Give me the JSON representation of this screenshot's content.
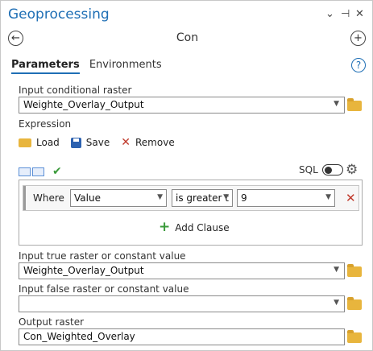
{
  "header": {
    "title": "Geoprocessing",
    "controls": {
      "dropdown": "⌄",
      "pin": "⊣",
      "close": "✕"
    }
  },
  "nav": {
    "back": "←",
    "tool_name": "Con",
    "add": "+"
  },
  "tabs": [
    {
      "label": "Parameters",
      "active": true
    },
    {
      "label": "Environments",
      "active": false
    }
  ],
  "help": "?",
  "params": {
    "cond_raster": {
      "label": "Input conditional raster",
      "value": "Weighte_Overlay_Output"
    },
    "expression": {
      "label": "Expression",
      "buttons": {
        "load": "Load",
        "save": "Save",
        "remove": "Remove"
      },
      "sql_label": "SQL",
      "clause": {
        "where": "Where",
        "field": "Value",
        "operator": "is greater t",
        "value": "9"
      },
      "add_clause": "Add Clause"
    },
    "true_raster": {
      "label": "Input true raster or constant value",
      "value": "Weighte_Overlay_Output"
    },
    "false_raster": {
      "label": "Input false raster or constant value",
      "value": ""
    },
    "output_raster": {
      "label": "Output raster",
      "value": "Con_Weighted_Overlay"
    }
  },
  "colors": {
    "accent": "#1f6fb5",
    "folder": "#e8b53d",
    "remove": "#c0392b",
    "add": "#3a9a3a"
  }
}
